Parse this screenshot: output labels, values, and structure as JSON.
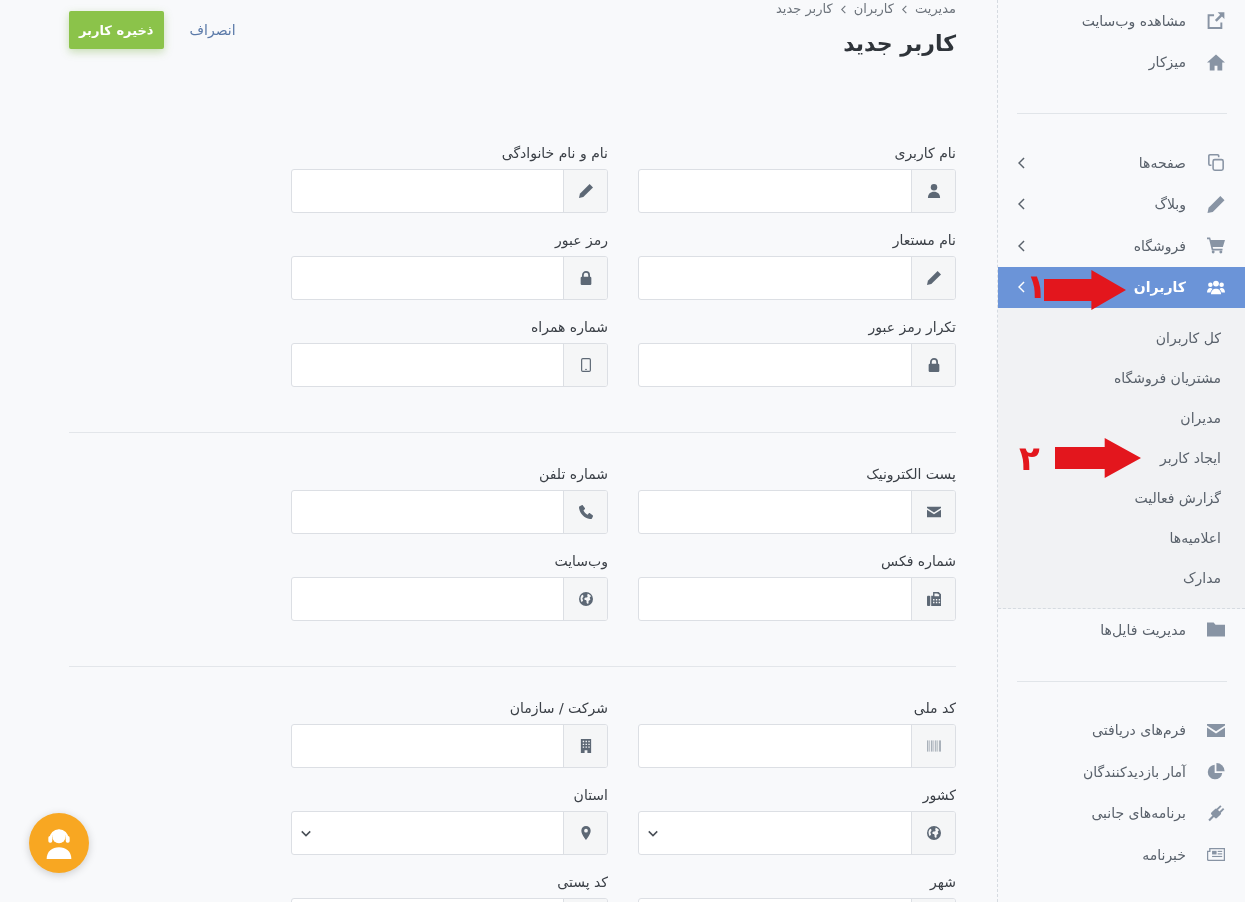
{
  "header": {
    "breadcrumb": [
      {
        "label": "مدیریت"
      },
      {
        "label": "کاربران"
      },
      {
        "label": "کاربر جدید"
      }
    ],
    "title": "کاربر جدید",
    "cancel_link": "انصراف",
    "save_button": "ذخیره کاربر"
  },
  "form": {
    "sections": [
      {
        "fields": [
          {
            "label": "نام کاربری",
            "kind": "text"
          },
          {
            "label": "نام و نام خانوادگی",
            "kind": "text"
          },
          {
            "label": "نام مستعار",
            "kind": "text"
          },
          {
            "label": "رمز عبور",
            "kind": "text"
          },
          {
            "label": "تکرار رمز عبور",
            "kind": "text"
          },
          {
            "label": "شماره همراه",
            "kind": "text"
          }
        ]
      },
      {
        "fields": [
          {
            "label": "پست الکترونیک",
            "kind": "text"
          },
          {
            "label": "شماره تلفن",
            "kind": "text"
          },
          {
            "label": "شماره فکس",
            "kind": "text"
          },
          {
            "label": "وب‌سایت",
            "kind": "text"
          }
        ]
      },
      {
        "fields": [
          {
            "label": "کد ملی",
            "kind": "text"
          },
          {
            "label": "شرکت / سازمان",
            "kind": "text"
          },
          {
            "label": "کشور",
            "kind": "select"
          },
          {
            "label": "استان",
            "kind": "select"
          },
          {
            "label": "شهر",
            "kind": "text"
          },
          {
            "label": "کد پستی",
            "kind": "text"
          }
        ]
      }
    ]
  },
  "sidebar": {
    "groups": [
      {
        "items": [
          {
            "label": "مشاهده وب‌سایت",
            "kind": "link",
            "selected": false
          },
          {
            "label": "میزکار",
            "kind": "link",
            "selected": false
          }
        ]
      },
      {
        "items": [
          {
            "label": "صفحه‌ها",
            "kind": "menu",
            "selected": false
          },
          {
            "label": "وبلاگ",
            "kind": "menu",
            "selected": false
          },
          {
            "label": "فروشگاه",
            "kind": "menu",
            "selected": false
          },
          {
            "label": "کاربران",
            "kind": "menu",
            "selected": true,
            "annotation": "۱",
            "children": [
              {
                "label": "کل کاربران",
                "selected": false
              },
              {
                "label": "مشتریان فروشگاه",
                "selected": false
              },
              {
                "label": "مدیران",
                "selected": false
              },
              {
                "label": "ایجاد کاربر",
                "selected": false,
                "annotation": "۲"
              },
              {
                "label": "گزارش فعالیت",
                "selected": false
              },
              {
                "label": "اعلامیه‌ها",
                "selected": false
              },
              {
                "label": "مدارک",
                "selected": false
              }
            ]
          },
          {
            "label": "مدیریت فایل‌ها",
            "kind": "link",
            "selected": false
          }
        ]
      },
      {
        "items": [
          {
            "label": "فرم‌های دریافتی",
            "kind": "link",
            "selected": false
          },
          {
            "label": "آمار بازدیدکنندگان",
            "kind": "link",
            "selected": false
          },
          {
            "label": "برنامه‌های جانبی",
            "kind": "link",
            "selected": false
          },
          {
            "label": "خبرنامه",
            "kind": "link",
            "selected": false
          }
        ]
      }
    ]
  }
}
